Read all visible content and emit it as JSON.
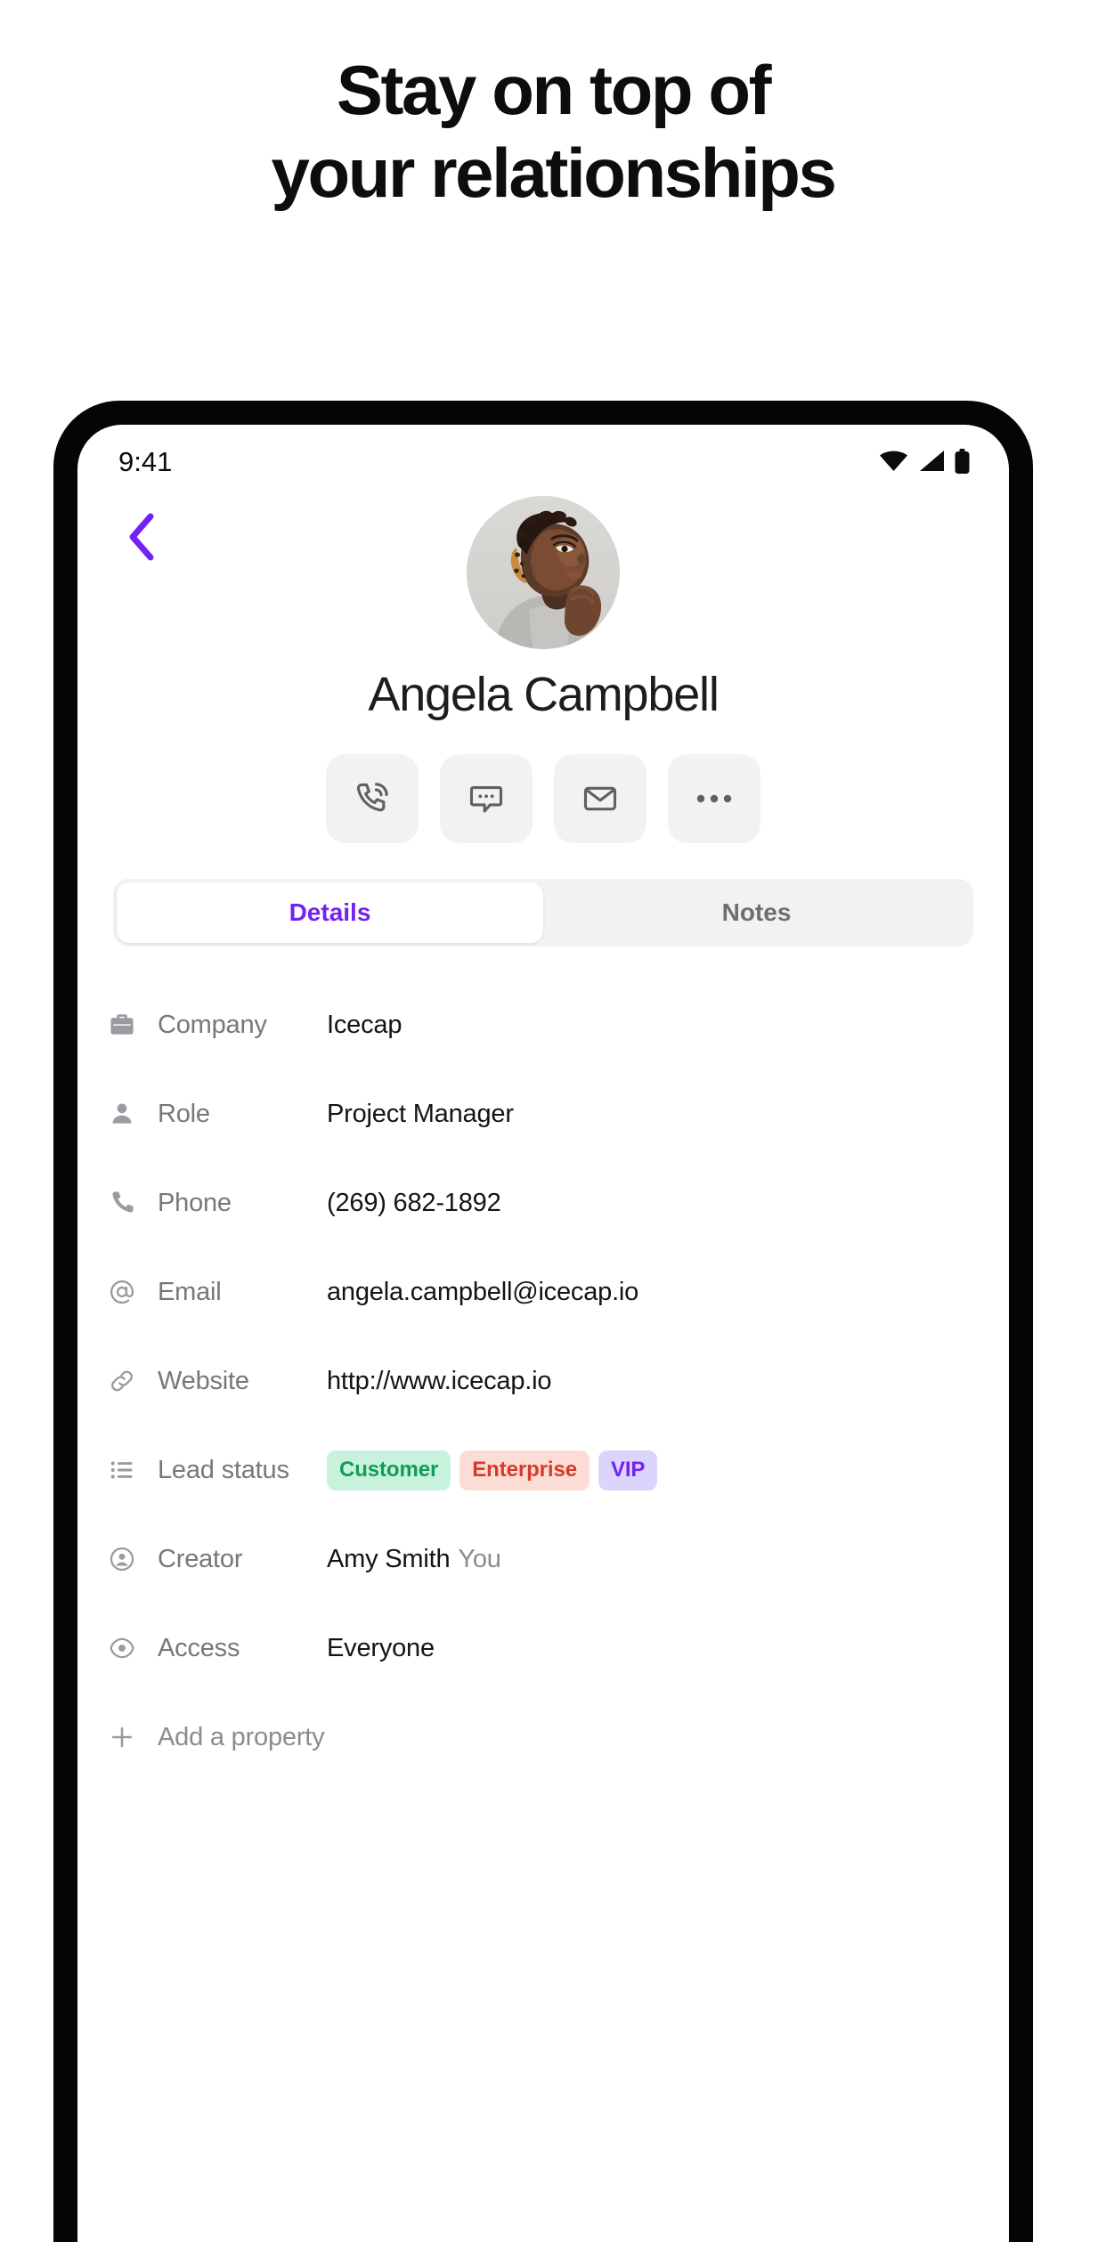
{
  "headline": {
    "line1": "Stay on top of",
    "line2": "your relationships"
  },
  "status_bar": {
    "time": "9:41",
    "icons": [
      "wifi-icon",
      "cellular-signal-icon",
      "battery-icon"
    ]
  },
  "nav": {
    "back_icon": "chevron-left-icon"
  },
  "contact": {
    "name": "Angela Campbell",
    "avatar_alt": "avatar"
  },
  "actions": [
    {
      "name": "call-button",
      "icon": "phone-call-icon"
    },
    {
      "name": "message-button",
      "icon": "message-bubble-icon"
    },
    {
      "name": "email-button",
      "icon": "envelope-icon"
    },
    {
      "name": "more-button",
      "icon": "ellipsis-icon"
    }
  ],
  "tabs": [
    {
      "label": "Details",
      "active": true
    },
    {
      "label": "Notes",
      "active": false
    }
  ],
  "details": {
    "rows": [
      {
        "icon": "briefcase-icon",
        "label": "Company",
        "value": "Icecap"
      },
      {
        "icon": "person-icon",
        "label": "Role",
        "value": "Project Manager"
      },
      {
        "icon": "phone-icon",
        "label": "Phone",
        "value": "(269) 682-1892"
      },
      {
        "icon": "at-sign-icon",
        "label": "Email",
        "value": "angela.campbell@icecap.io"
      },
      {
        "icon": "link-icon",
        "label": "Website",
        "value": "http://www.icecap.io"
      },
      {
        "icon": "list-icon",
        "label": "Lead status",
        "value": ""
      },
      {
        "icon": "user-circle-icon",
        "label": "Creator",
        "value": "Amy Smith",
        "value_suffix": "You"
      },
      {
        "icon": "eye-icon",
        "label": "Access",
        "value": "Everyone"
      }
    ],
    "lead_status_chips": [
      {
        "label": "Customer",
        "bg": "#c9f2de",
        "fg": "#0f9d58"
      },
      {
        "label": "Enterprise",
        "bg": "#fbddd6",
        "fg": "#d73a28"
      },
      {
        "label": "VIP",
        "bg": "#ddd4fd",
        "fg": "#7322f5"
      }
    ],
    "add_property": {
      "icon": "plus-icon",
      "label": "Add a property"
    }
  },
  "colors": {
    "accent_purple": "#7322f5",
    "text_primary": "#141416",
    "text_muted": "#77777c",
    "surface": "#f2f2f3",
    "bezel": "#050505"
  }
}
